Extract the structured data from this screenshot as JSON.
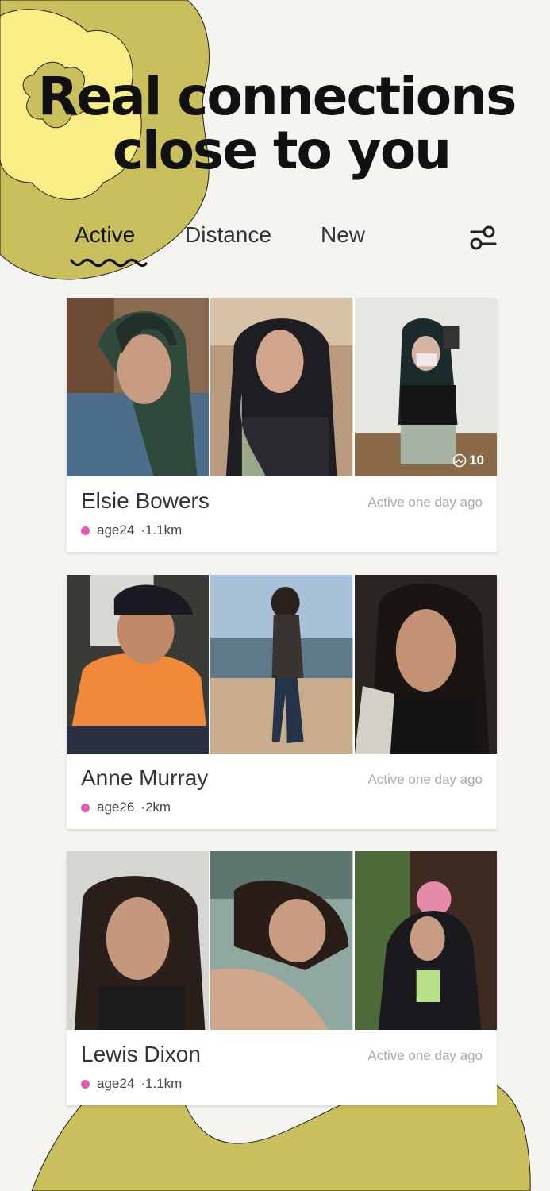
{
  "colors": {
    "background": "#f5f4f0",
    "blob_olive": "#c9bf5c",
    "blob_yellow": "#f9ed86",
    "status_dot": "#e05ab8"
  },
  "headline": {
    "line1": "Real connections",
    "line2": "close to you"
  },
  "tabs": [
    {
      "label": "Active",
      "selected": true
    },
    {
      "label": "Distance",
      "selected": false
    },
    {
      "label": "New",
      "selected": false
    }
  ],
  "filter_icon": "filter-sliders-icon",
  "cards": [
    {
      "name": "Elsie Bowers",
      "age": "age24",
      "distance": "·1.1km",
      "active": "Active one day ago",
      "more_photos": "10",
      "photos": [
        "photo-girl-green-hair-hand",
        "photo-girl-headphones",
        "photo-girl-mirror-selfie"
      ]
    },
    {
      "name": "Anne Murray",
      "age": "age26",
      "distance": "·2km",
      "active": "Active one day ago",
      "photos": [
        "photo-person-orange-jacket-cap",
        "photo-person-beach",
        "photo-person-dark-room"
      ]
    },
    {
      "name": "Lewis Dixon",
      "age": "age24",
      "distance": "·1.1km",
      "active": "Active one day ago",
      "photos": [
        "photo-girl-hand-face",
        "photo-girl-lying",
        "photo-girl-green-wall"
      ]
    }
  ]
}
